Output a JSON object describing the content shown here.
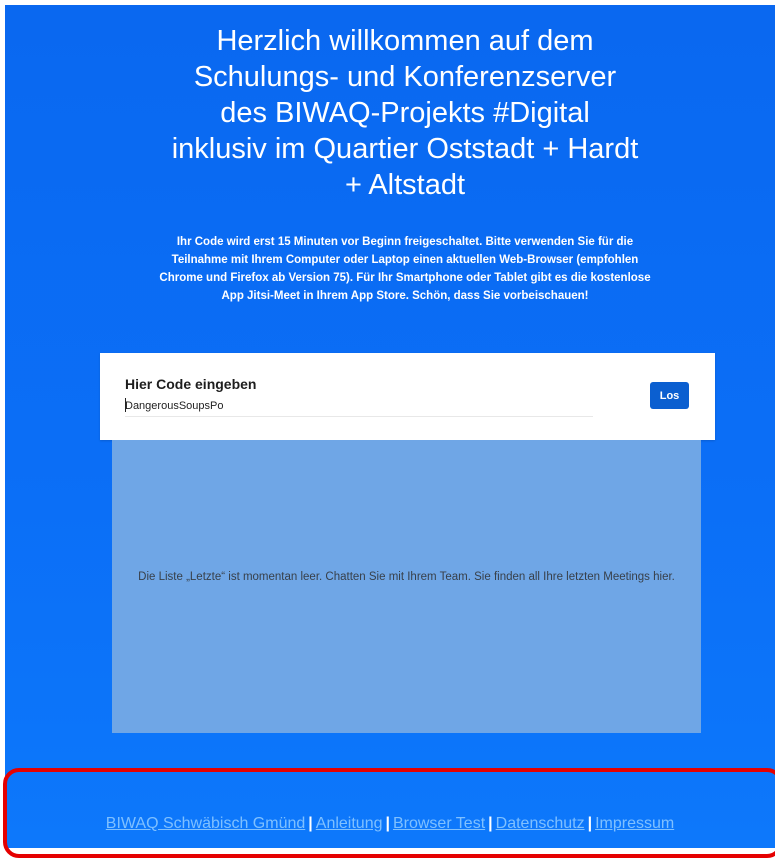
{
  "header": {
    "title_lines": [
      "Herzlich willkommen auf dem",
      "Schulungs- und Konferenzserver",
      "des BIWAQ-Projekts #Digital",
      "inklusiv im Quartier Oststadt + Hardt",
      "+ Altstadt"
    ],
    "subtitle_lines": [
      "Ihr Code wird erst 15 Minuten vor Beginn freigeschaltet. Bitte verwenden Sie für die",
      "Teilnahme mit Ihrem Computer oder Laptop einen aktuellen Web-Browser (empfohlen",
      "Chrome und Firefox ab Version 75). Für Ihr Smartphone oder Tablet gibt es die kostenlose",
      "App Jitsi-Meet in Ihrem App Store. Schön, dass Sie vorbeischauen!"
    ]
  },
  "code_entry": {
    "label": "Hier Code eingeben",
    "value": "DangerousSoupsPo",
    "button_label": "Los"
  },
  "recent": {
    "empty_text": "Die Liste „Letzte“ ist momentan leer. Chatten Sie mit Ihrem Team. Sie finden all Ihre letzten Meetings hier."
  },
  "footer": {
    "links": [
      "BIWAQ Schwäbisch Gmünd",
      "Anleitung",
      "Browser Test",
      "Datenschutz",
      "Impressum"
    ],
    "separator": "|"
  },
  "colors": {
    "background": "#0b6ff7",
    "recent_panel": "#6fa6e6",
    "button": "#0b5fd0",
    "link": "#7fc0ff",
    "highlight": "#e50000"
  }
}
